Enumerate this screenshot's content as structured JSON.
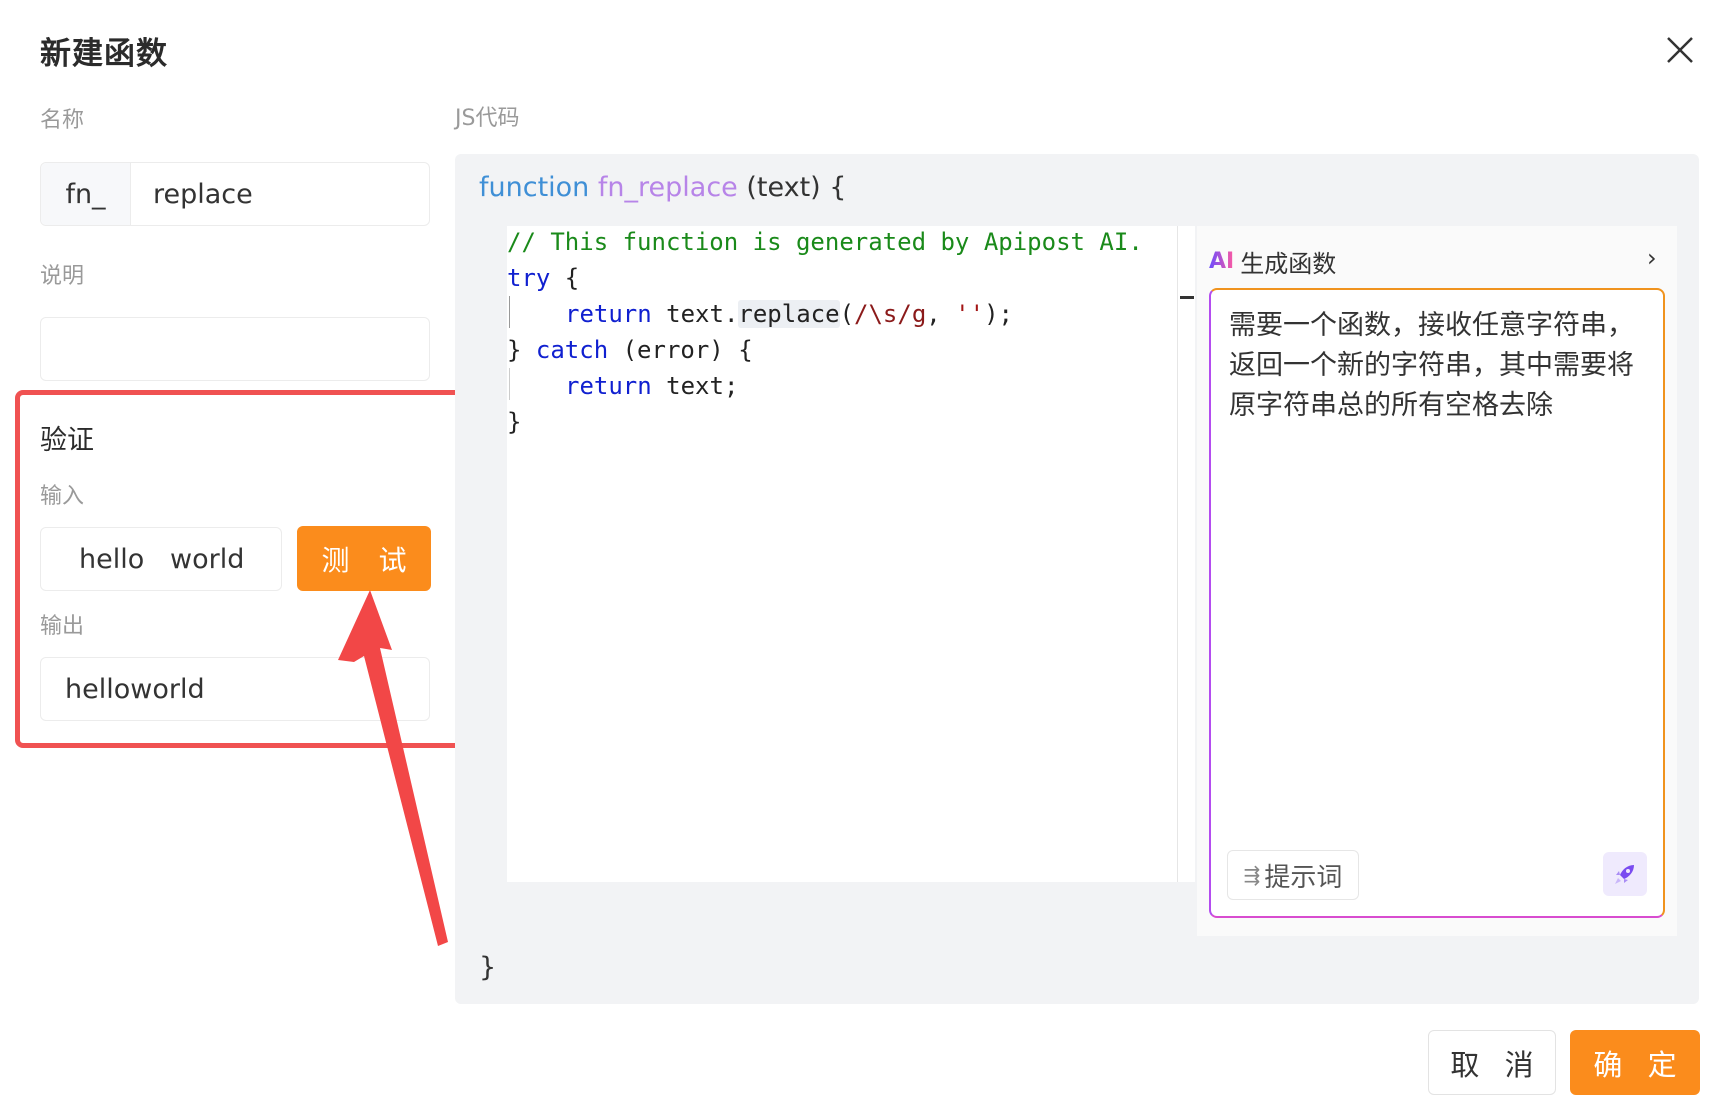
{
  "dialog": {
    "title": "新建函数",
    "close_icon": "close-icon"
  },
  "form": {
    "name_label": "名称",
    "name_prefix": "fn_",
    "name_value": "replace",
    "desc_label": "说明",
    "desc_value": ""
  },
  "verify": {
    "title": "验证",
    "input_label": "输入",
    "input_value": "hello   world",
    "test_button": "测 试",
    "output_label": "输出",
    "output_value": "helloworld",
    "highlight_color": "#f05252"
  },
  "code": {
    "label": "JS代码",
    "sig_keyword": "function",
    "sig_name": "fn_replace",
    "sig_rest": " (text) {",
    "closing_brace": "}",
    "lines": {
      "l1": "// This function is generated by Apipost AI.",
      "l2_kw": "try",
      "l2_rest": " {",
      "l3_kw": "return",
      "l3_a": " text.",
      "l3_method": "replace",
      "l3_b": "(",
      "l3_regex": "/\\s/g",
      "l3_c": ", ",
      "l3_str": "''",
      "l3_d": ");",
      "l4_a": "} ",
      "l4_kw": "catch",
      "l4_rest": " (error) {",
      "l5_kw": "return",
      "l5_rest": " text;",
      "l6": "}"
    }
  },
  "ai": {
    "logo": "AI",
    "title": "生成函数",
    "chevron": "›",
    "prompt_text": "需要一个函数，接收任意字符串，返回一个新的字符串，其中需要将原字符串总的所有空格去除",
    "prompt_button": "提示词",
    "send_icon": "rocket-icon"
  },
  "footer": {
    "cancel": "取 消",
    "confirm": "确 定"
  },
  "colors": {
    "accent": "#fb8c1c",
    "keyword": "#1020d0",
    "comment": "#1a8a1a"
  }
}
